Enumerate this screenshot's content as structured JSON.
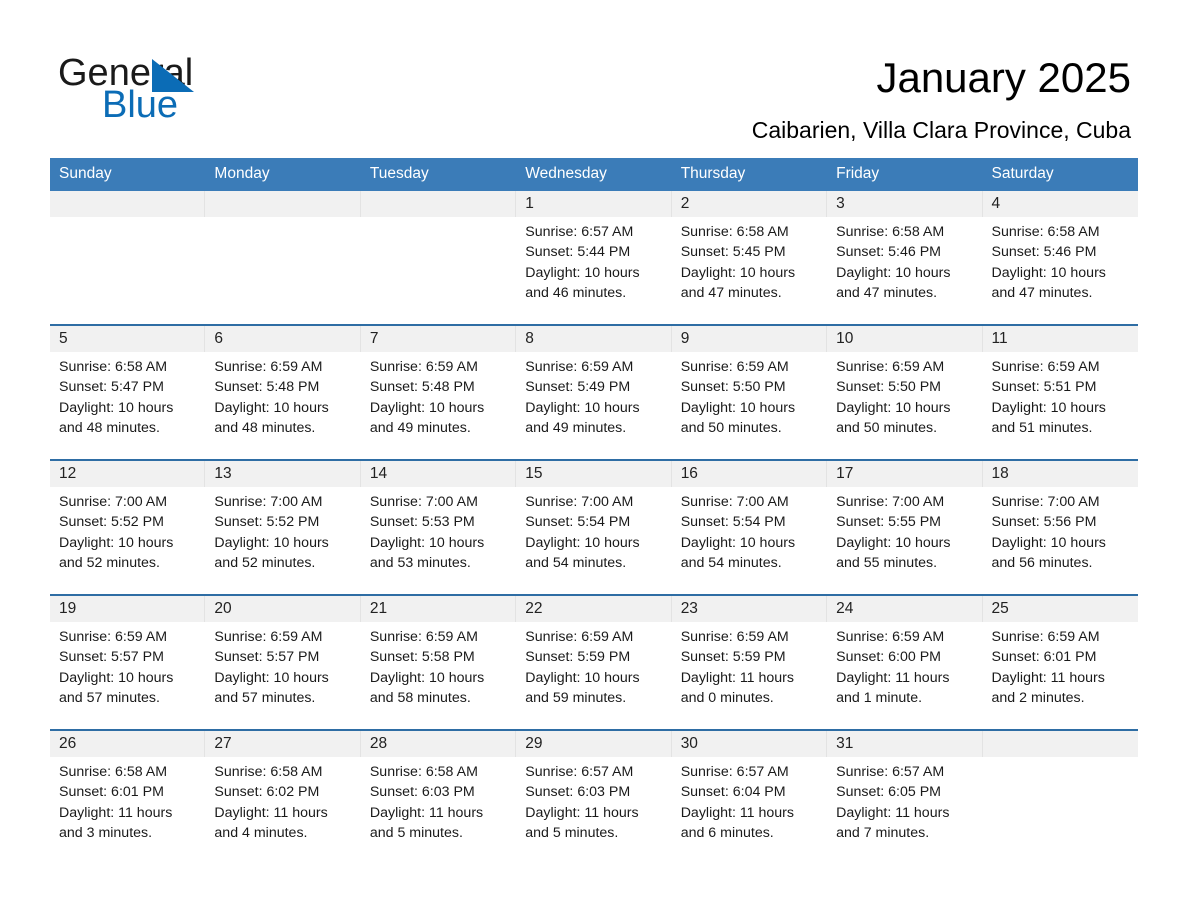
{
  "brand": {
    "name_part1": "General",
    "name_part2": "Blue",
    "triangle_color": "#0b6cb6",
    "accent_color": "#3b7cb8"
  },
  "header": {
    "title": "January 2025",
    "subtitle": "Caibarien, Villa Clara Province, Cuba"
  },
  "calendar": {
    "weekday_headers": [
      "Sunday",
      "Monday",
      "Tuesday",
      "Wednesday",
      "Thursday",
      "Friday",
      "Saturday"
    ],
    "weeks": [
      [
        {
          "day": "",
          "empty": true,
          "sunrise": "",
          "sunset": "",
          "daylight_line1": "",
          "daylight_line2": ""
        },
        {
          "day": "",
          "empty": true,
          "sunrise": "",
          "sunset": "",
          "daylight_line1": "",
          "daylight_line2": ""
        },
        {
          "day": "",
          "empty": true,
          "sunrise": "",
          "sunset": "",
          "daylight_line1": "",
          "daylight_line2": ""
        },
        {
          "day": "1",
          "empty": false,
          "sunrise": "Sunrise: 6:57 AM",
          "sunset": "Sunset: 5:44 PM",
          "daylight_line1": "Daylight: 10 hours",
          "daylight_line2": "and 46 minutes."
        },
        {
          "day": "2",
          "empty": false,
          "sunrise": "Sunrise: 6:58 AM",
          "sunset": "Sunset: 5:45 PM",
          "daylight_line1": "Daylight: 10 hours",
          "daylight_line2": "and 47 minutes."
        },
        {
          "day": "3",
          "empty": false,
          "sunrise": "Sunrise: 6:58 AM",
          "sunset": "Sunset: 5:46 PM",
          "daylight_line1": "Daylight: 10 hours",
          "daylight_line2": "and 47 minutes."
        },
        {
          "day": "4",
          "empty": false,
          "sunrise": "Sunrise: 6:58 AM",
          "sunset": "Sunset: 5:46 PM",
          "daylight_line1": "Daylight: 10 hours",
          "daylight_line2": "and 47 minutes."
        }
      ],
      [
        {
          "day": "5",
          "empty": false,
          "sunrise": "Sunrise: 6:58 AM",
          "sunset": "Sunset: 5:47 PM",
          "daylight_line1": "Daylight: 10 hours",
          "daylight_line2": "and 48 minutes."
        },
        {
          "day": "6",
          "empty": false,
          "sunrise": "Sunrise: 6:59 AM",
          "sunset": "Sunset: 5:48 PM",
          "daylight_line1": "Daylight: 10 hours",
          "daylight_line2": "and 48 minutes."
        },
        {
          "day": "7",
          "empty": false,
          "sunrise": "Sunrise: 6:59 AM",
          "sunset": "Sunset: 5:48 PM",
          "daylight_line1": "Daylight: 10 hours",
          "daylight_line2": "and 49 minutes."
        },
        {
          "day": "8",
          "empty": false,
          "sunrise": "Sunrise: 6:59 AM",
          "sunset": "Sunset: 5:49 PM",
          "daylight_line1": "Daylight: 10 hours",
          "daylight_line2": "and 49 minutes."
        },
        {
          "day": "9",
          "empty": false,
          "sunrise": "Sunrise: 6:59 AM",
          "sunset": "Sunset: 5:50 PM",
          "daylight_line1": "Daylight: 10 hours",
          "daylight_line2": "and 50 minutes."
        },
        {
          "day": "10",
          "empty": false,
          "sunrise": "Sunrise: 6:59 AM",
          "sunset": "Sunset: 5:50 PM",
          "daylight_line1": "Daylight: 10 hours",
          "daylight_line2": "and 50 minutes."
        },
        {
          "day": "11",
          "empty": false,
          "sunrise": "Sunrise: 6:59 AM",
          "sunset": "Sunset: 5:51 PM",
          "daylight_line1": "Daylight: 10 hours",
          "daylight_line2": "and 51 minutes."
        }
      ],
      [
        {
          "day": "12",
          "empty": false,
          "sunrise": "Sunrise: 7:00 AM",
          "sunset": "Sunset: 5:52 PM",
          "daylight_line1": "Daylight: 10 hours",
          "daylight_line2": "and 52 minutes."
        },
        {
          "day": "13",
          "empty": false,
          "sunrise": "Sunrise: 7:00 AM",
          "sunset": "Sunset: 5:52 PM",
          "daylight_line1": "Daylight: 10 hours",
          "daylight_line2": "and 52 minutes."
        },
        {
          "day": "14",
          "empty": false,
          "sunrise": "Sunrise: 7:00 AM",
          "sunset": "Sunset: 5:53 PM",
          "daylight_line1": "Daylight: 10 hours",
          "daylight_line2": "and 53 minutes."
        },
        {
          "day": "15",
          "empty": false,
          "sunrise": "Sunrise: 7:00 AM",
          "sunset": "Sunset: 5:54 PM",
          "daylight_line1": "Daylight: 10 hours",
          "daylight_line2": "and 54 minutes."
        },
        {
          "day": "16",
          "empty": false,
          "sunrise": "Sunrise: 7:00 AM",
          "sunset": "Sunset: 5:54 PM",
          "daylight_line1": "Daylight: 10 hours",
          "daylight_line2": "and 54 minutes."
        },
        {
          "day": "17",
          "empty": false,
          "sunrise": "Sunrise: 7:00 AM",
          "sunset": "Sunset: 5:55 PM",
          "daylight_line1": "Daylight: 10 hours",
          "daylight_line2": "and 55 minutes."
        },
        {
          "day": "18",
          "empty": false,
          "sunrise": "Sunrise: 7:00 AM",
          "sunset": "Sunset: 5:56 PM",
          "daylight_line1": "Daylight: 10 hours",
          "daylight_line2": "and 56 minutes."
        }
      ],
      [
        {
          "day": "19",
          "empty": false,
          "sunrise": "Sunrise: 6:59 AM",
          "sunset": "Sunset: 5:57 PM",
          "daylight_line1": "Daylight: 10 hours",
          "daylight_line2": "and 57 minutes."
        },
        {
          "day": "20",
          "empty": false,
          "sunrise": "Sunrise: 6:59 AM",
          "sunset": "Sunset: 5:57 PM",
          "daylight_line1": "Daylight: 10 hours",
          "daylight_line2": "and 57 minutes."
        },
        {
          "day": "21",
          "empty": false,
          "sunrise": "Sunrise: 6:59 AM",
          "sunset": "Sunset: 5:58 PM",
          "daylight_line1": "Daylight: 10 hours",
          "daylight_line2": "and 58 minutes."
        },
        {
          "day": "22",
          "empty": false,
          "sunrise": "Sunrise: 6:59 AM",
          "sunset": "Sunset: 5:59 PM",
          "daylight_line1": "Daylight: 10 hours",
          "daylight_line2": "and 59 minutes."
        },
        {
          "day": "23",
          "empty": false,
          "sunrise": "Sunrise: 6:59 AM",
          "sunset": "Sunset: 5:59 PM",
          "daylight_line1": "Daylight: 11 hours",
          "daylight_line2": "and 0 minutes."
        },
        {
          "day": "24",
          "empty": false,
          "sunrise": "Sunrise: 6:59 AM",
          "sunset": "Sunset: 6:00 PM",
          "daylight_line1": "Daylight: 11 hours",
          "daylight_line2": "and 1 minute."
        },
        {
          "day": "25",
          "empty": false,
          "sunrise": "Sunrise: 6:59 AM",
          "sunset": "Sunset: 6:01 PM",
          "daylight_line1": "Daylight: 11 hours",
          "daylight_line2": "and 2 minutes."
        }
      ],
      [
        {
          "day": "26",
          "empty": false,
          "sunrise": "Sunrise: 6:58 AM",
          "sunset": "Sunset: 6:01 PM",
          "daylight_line1": "Daylight: 11 hours",
          "daylight_line2": "and 3 minutes."
        },
        {
          "day": "27",
          "empty": false,
          "sunrise": "Sunrise: 6:58 AM",
          "sunset": "Sunset: 6:02 PM",
          "daylight_line1": "Daylight: 11 hours",
          "daylight_line2": "and 4 minutes."
        },
        {
          "day": "28",
          "empty": false,
          "sunrise": "Sunrise: 6:58 AM",
          "sunset": "Sunset: 6:03 PM",
          "daylight_line1": "Daylight: 11 hours",
          "daylight_line2": "and 5 minutes."
        },
        {
          "day": "29",
          "empty": false,
          "sunrise": "Sunrise: 6:57 AM",
          "sunset": "Sunset: 6:03 PM",
          "daylight_line1": "Daylight: 11 hours",
          "daylight_line2": "and 5 minutes."
        },
        {
          "day": "30",
          "empty": false,
          "sunrise": "Sunrise: 6:57 AM",
          "sunset": "Sunset: 6:04 PM",
          "daylight_line1": "Daylight: 11 hours",
          "daylight_line2": "and 6 minutes."
        },
        {
          "day": "31",
          "empty": false,
          "sunrise": "Sunrise: 6:57 AM",
          "sunset": "Sunset: 6:05 PM",
          "daylight_line1": "Daylight: 11 hours",
          "daylight_line2": "and 7 minutes."
        },
        {
          "day": "",
          "empty": true,
          "sunrise": "",
          "sunset": "",
          "daylight_line1": "",
          "daylight_line2": ""
        }
      ]
    ]
  }
}
